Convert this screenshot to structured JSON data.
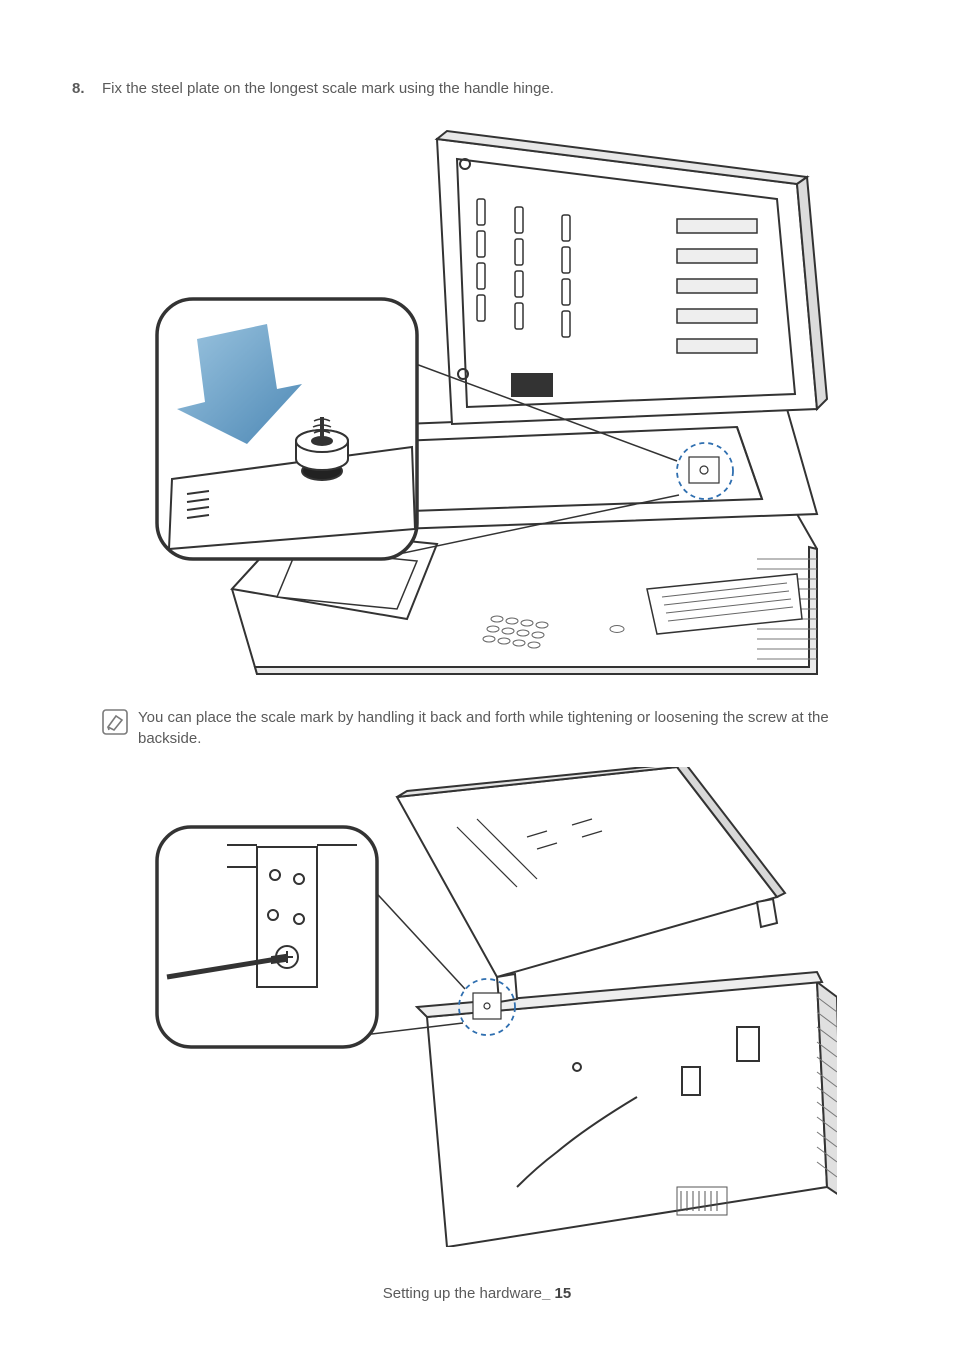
{
  "step": {
    "number": "8.",
    "text": "Fix the steel plate on the longest scale mark using the handle hinge."
  },
  "note": {
    "icon": "note-icon",
    "text": "You can place the scale mark by handling it back and forth while tightening or loosening the screw at the backside."
  },
  "footer": {
    "section": "Setting up the hardware",
    "separator": "_",
    "page": "15"
  }
}
